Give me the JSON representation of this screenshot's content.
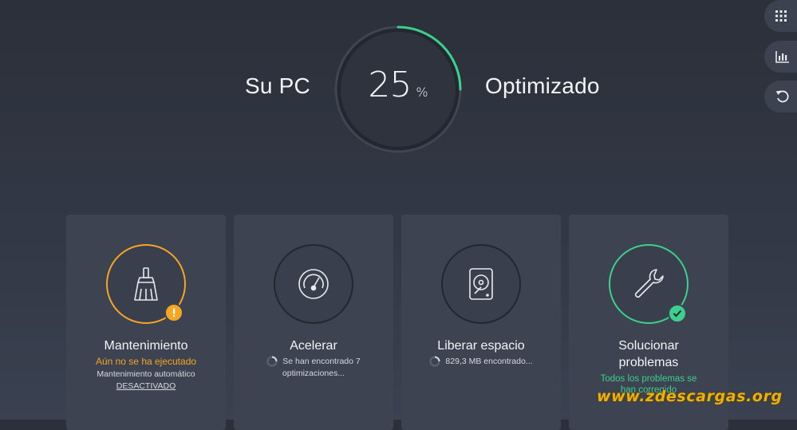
{
  "hero": {
    "left_text": "Su PC",
    "percent": "25",
    "percent_unit": "%",
    "percent_value": 25,
    "right_text": "Optimizado"
  },
  "side_buttons": [
    {
      "icon": "grid-icon"
    },
    {
      "icon": "bar-chart-icon"
    },
    {
      "icon": "undo-icon"
    }
  ],
  "cards": [
    {
      "icon": "broom-icon",
      "title": "Mantenimiento",
      "status": "Aún no se ha ejecutado",
      "detail": "Mantenimiento automático",
      "link": "DESACTIVADO",
      "badge": "warning"
    },
    {
      "icon": "speedometer-icon",
      "title": "Acelerar",
      "status_line1": "Se han encontrado 7",
      "status_line2": "optimizaciones..."
    },
    {
      "icon": "hard-drive-icon",
      "title": "Liberar espacio",
      "status_line1": "829,3 MB encontrado..."
    },
    {
      "icon": "wrench-icon",
      "title_line1": "Solucionar",
      "title_line2": "problemas",
      "status_line1": "Todos los problemas se",
      "status_line2": "han corregido",
      "badge": "ok"
    }
  ],
  "colors": {
    "accent_green": "#3ccf8e",
    "warning_orange": "#f5a623",
    "background": "#2f3440",
    "card": "#3d4351"
  },
  "watermark": "www.zdescargas.org"
}
